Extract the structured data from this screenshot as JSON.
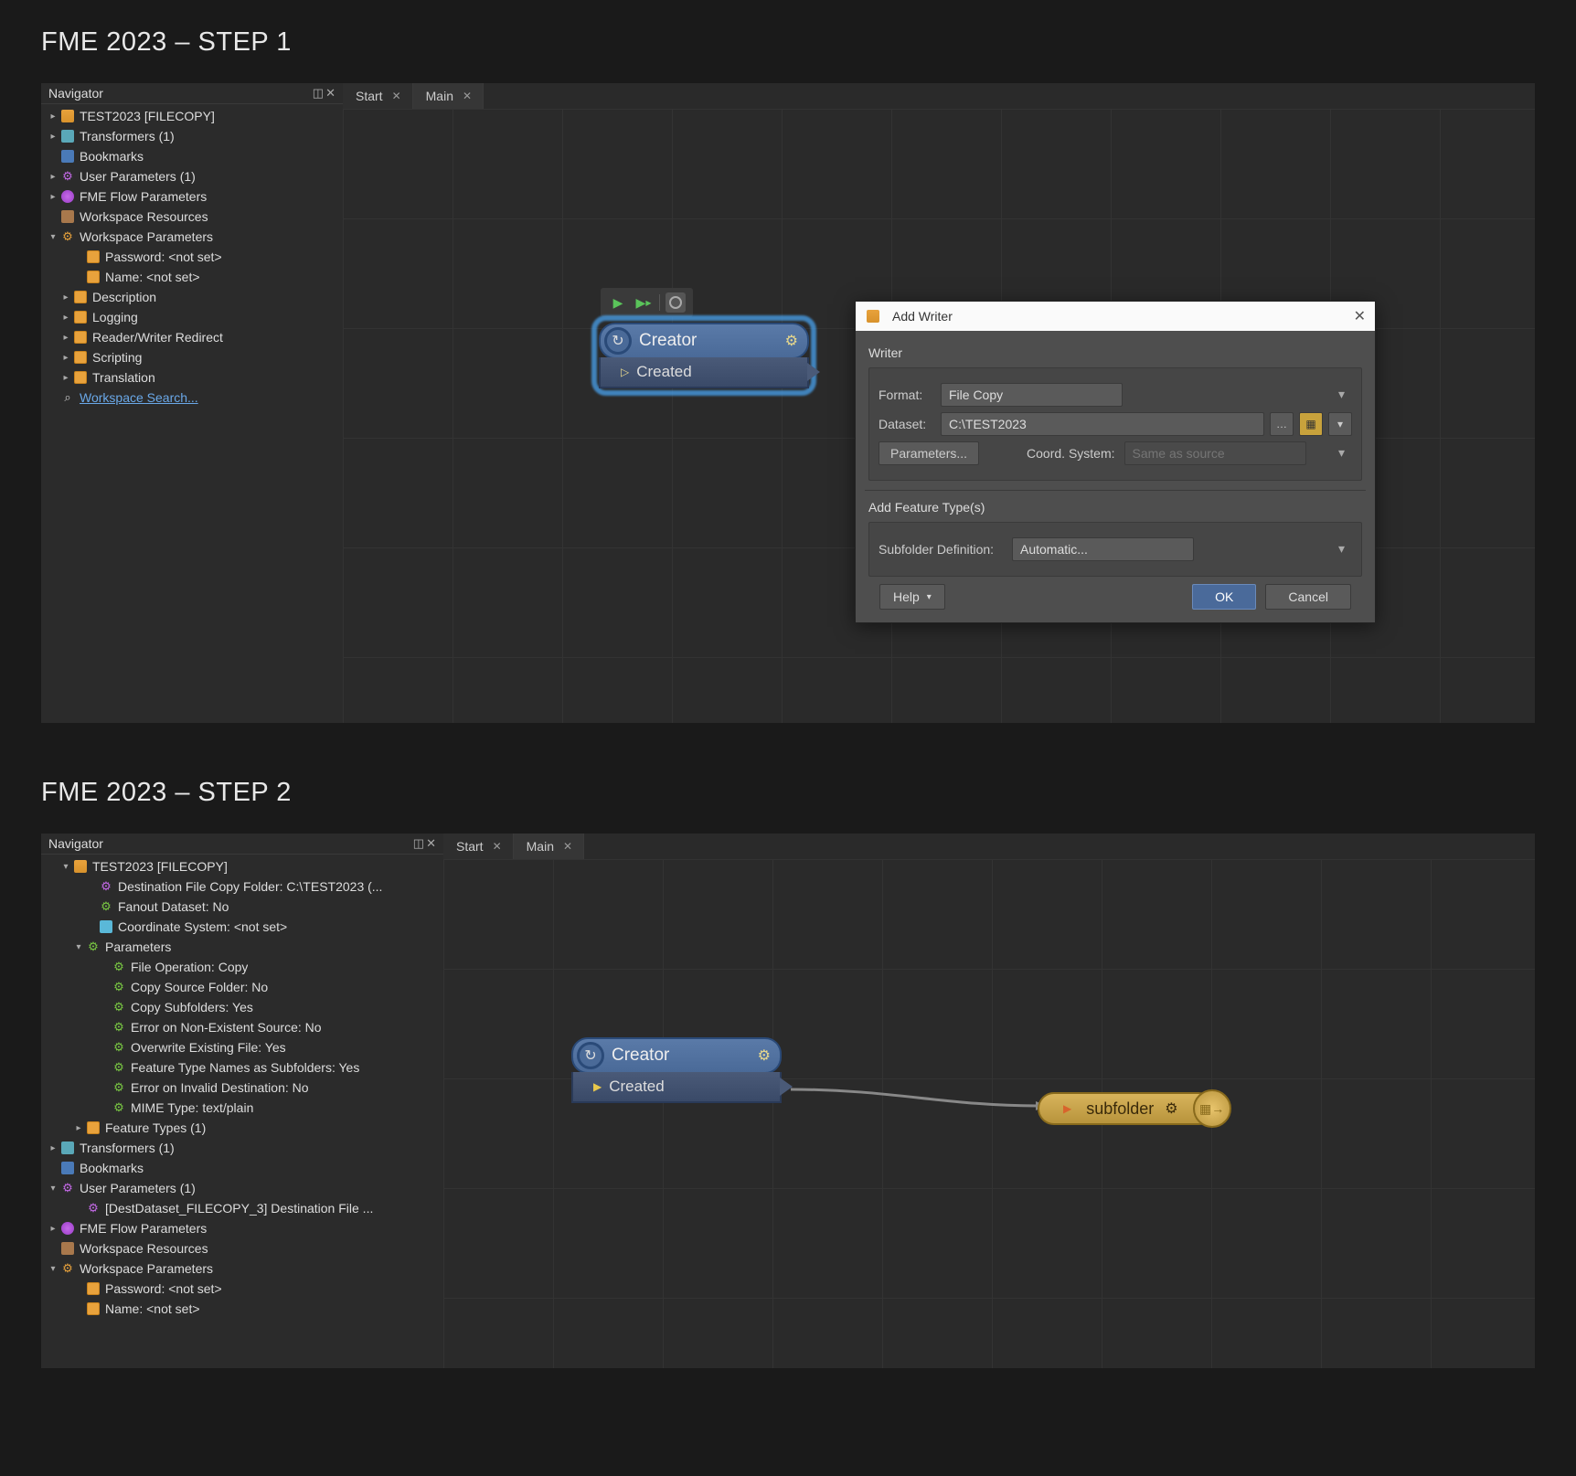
{
  "step1": {
    "title": "FME 2023 – STEP 1",
    "navigator": {
      "title": "Navigator",
      "items": {
        "workspace": "TEST2023 [FILECOPY]",
        "transformers": "Transformers (1)",
        "bookmarks": "Bookmarks",
        "user_params": "User Parameters (1)",
        "flow_params": "FME Flow Parameters",
        "ws_resources": "Workspace Resources",
        "ws_params": "Workspace Parameters",
        "password": "Password: <not set>",
        "name": "Name: <not set>",
        "description": "Description",
        "logging": "Logging",
        "rw_redirect": "Reader/Writer Redirect",
        "scripting": "Scripting",
        "translation": "Translation",
        "search": "Workspace Search..."
      }
    },
    "tabs": {
      "start": "Start",
      "main": "Main"
    },
    "node": {
      "name": "Creator",
      "port": "Created"
    },
    "dialog": {
      "title": "Add Writer",
      "writer_label": "Writer",
      "format_label": "Format:",
      "format_value": "File Copy",
      "dataset_label": "Dataset:",
      "dataset_value": "C:\\TEST2023",
      "params_btn": "Parameters...",
      "coord_label": "Coord. System:",
      "coord_placeholder": "Same as source",
      "ft_label": "Add Feature Type(s)",
      "subfolder_label": "Subfolder Definition:",
      "subfolder_value": "Automatic...",
      "help": "Help",
      "ok": "OK",
      "cancel": "Cancel"
    }
  },
  "step2": {
    "title": "FME 2023 – STEP 2",
    "navigator": {
      "title": "Navigator",
      "items": {
        "workspace": "TEST2023 [FILECOPY]",
        "dest": "Destination File Copy Folder: C:\\TEST2023 (...",
        "fanout": "Fanout Dataset: No",
        "coord": "Coordinate System: <not set>",
        "params": "Parameters",
        "file_op": "File Operation: Copy",
        "copy_src": "Copy Source Folder: No",
        "copy_sub": "Copy Subfolders: Yes",
        "err_nes": "Error on Non-Existent Source: No",
        "overwrite": "Overwrite Existing File: Yes",
        "ftnas": "Feature Type Names as Subfolders: Yes",
        "err_inv": "Error on Invalid Destination: No",
        "mime": "MIME Type: text/plain",
        "feature_types": "Feature Types (1)",
        "transformers": "Transformers (1)",
        "bookmarks": "Bookmarks",
        "user_params": "User Parameters (1)",
        "dest_user": "[DestDataset_FILECOPY_3] Destination File ...",
        "flow_params": "FME Flow Parameters",
        "ws_resources": "Workspace Resources",
        "ws_params": "Workspace Parameters",
        "password": "Password: <not set>",
        "name": "Name: <not set>"
      }
    },
    "tabs": {
      "start": "Start",
      "main": "Main"
    },
    "node": {
      "name": "Creator",
      "port": "Created"
    },
    "writer": {
      "name": "subfolder"
    }
  }
}
